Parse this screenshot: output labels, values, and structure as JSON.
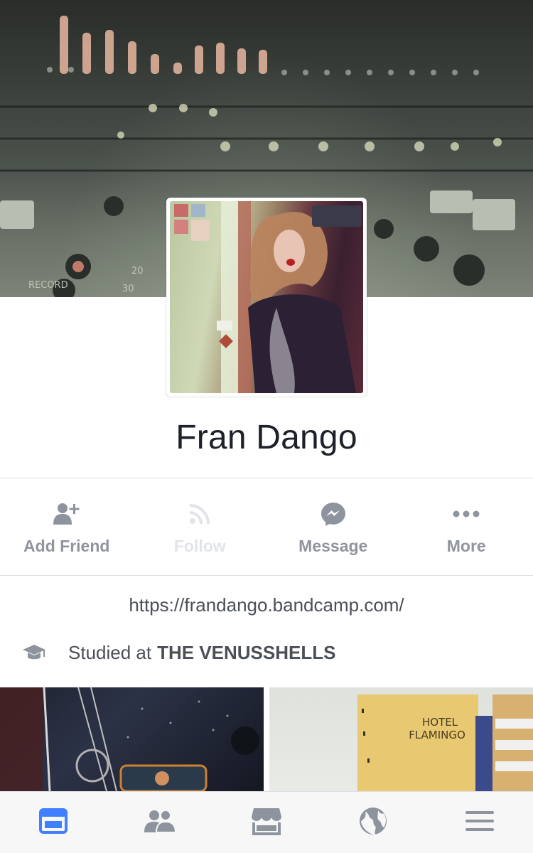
{
  "cover_photo": {
    "description_icon": "mixing-console-image"
  },
  "profile_picture": {
    "icon": "profile-photo"
  },
  "profile": {
    "name": "Fran Dango"
  },
  "actions": [
    {
      "label": "Add Friend",
      "icon": "add-friend-icon",
      "enabled": true
    },
    {
      "label": "Follow",
      "icon": "follow-icon",
      "enabled": false
    },
    {
      "label": "Message",
      "icon": "messenger-icon",
      "enabled": true
    },
    {
      "label": "More",
      "icon": "more-icon",
      "enabled": true
    }
  ],
  "about": {
    "website": "https://frandango.bandcamp.com/",
    "education_prefix": "Studied at",
    "education_school": "THE VENUSSHELLS"
  },
  "photos": {
    "photo_2_sign_line1": "HOTEL",
    "photo_2_sign_line2": "FLAMINGO"
  },
  "tabbar": {
    "items": [
      {
        "name": "news-feed",
        "active": true
      },
      {
        "name": "friends",
        "active": false
      },
      {
        "name": "marketplace",
        "active": false
      },
      {
        "name": "notifications-globe",
        "active": false
      },
      {
        "name": "menu",
        "active": false
      }
    ]
  },
  "colors": {
    "active_tab": "#4080ff",
    "inactive_icon": "#8d949e",
    "action_text": "#90949c",
    "disabled_text": "#e2e4e8",
    "name_text": "#1d2129"
  }
}
